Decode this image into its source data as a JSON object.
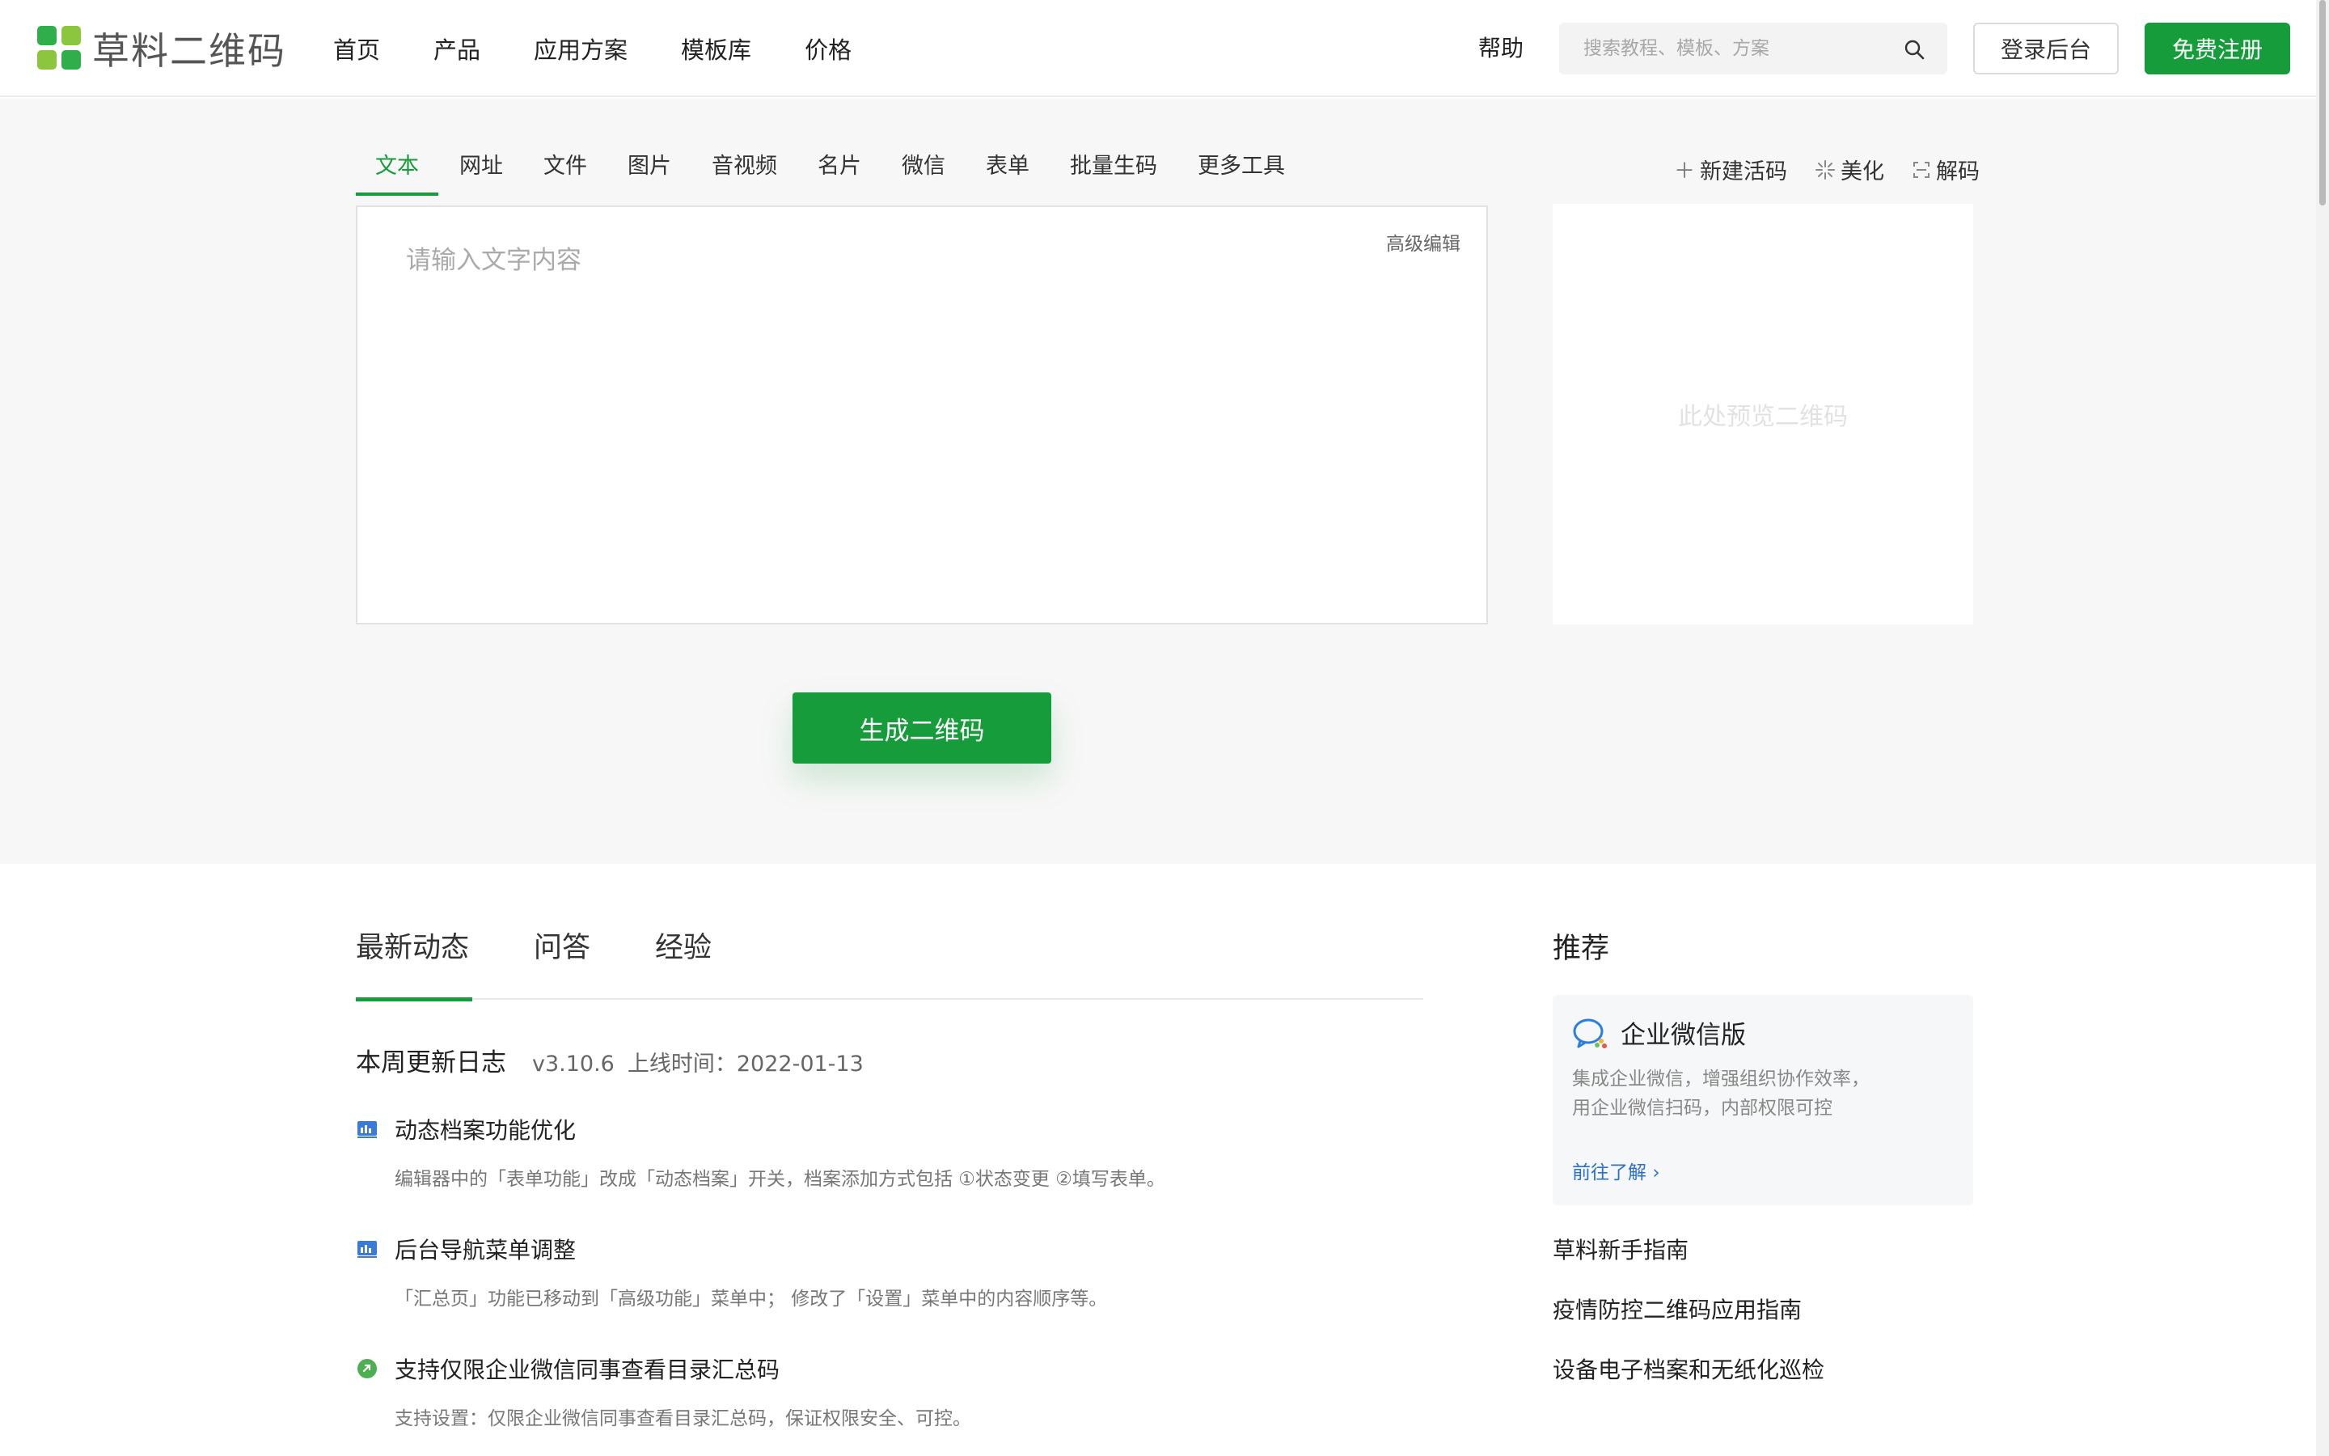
{
  "header": {
    "logo_text": "草料二维码",
    "nav": [
      "首页",
      "产品",
      "应用方案",
      "模板库",
      "价格"
    ],
    "help": "帮助",
    "search_placeholder": "搜索教程、模板、方案",
    "login": "登录后台",
    "register": "免费注册"
  },
  "generator": {
    "tabs": [
      "文本",
      "网址",
      "文件",
      "图片",
      "音视频",
      "名片",
      "微信",
      "表单",
      "批量生码",
      "更多工具"
    ],
    "active_tab": "文本",
    "tools": [
      {
        "icon": "plus-icon",
        "label": "新建活码"
      },
      {
        "icon": "sparkle-icon",
        "label": "美化"
      },
      {
        "icon": "scan-icon",
        "label": "解码"
      }
    ],
    "placeholder": "请输入文字内容",
    "advanced_edit": "高级编辑",
    "preview_text": "此处预览二维码",
    "generate_button": "生成二维码"
  },
  "news": {
    "tabs": [
      "最新动态",
      "问答",
      "经验"
    ],
    "week_title": "本周更新日志",
    "version": "v3.10.6",
    "release": "上线时间：2022-01-13",
    "items": [
      {
        "icon": "chart-icon",
        "title": "动态档案功能优化",
        "desc": "编辑器中的「表单功能」改成「动态档案」开关，档案添加方式包括 ①状态变更 ②填写表单。"
      },
      {
        "icon": "chart-icon",
        "title": "后台导航菜单调整",
        "desc": "「汇总页」功能已移动到「高级功能」菜单中； 修改了「设置」菜单中的内容顺序等。"
      },
      {
        "icon": "wecom-link-icon",
        "title": "支持仅限企业微信同事查看目录汇总码",
        "desc": "支持设置：仅限企业微信同事查看目录汇总码，保证权限安全、可控。"
      }
    ]
  },
  "recommend": {
    "title": "推荐",
    "card": {
      "title": "企业微信版",
      "desc_line1": "集成企业微信，增强组织协作效率，",
      "desc_line2": "用企业微信扫码，内部权限可控",
      "link": "前往了解"
    },
    "links": [
      "草料新手指南",
      "疫情防控二维码应用指南",
      "设备电子档案和无纸化巡检"
    ]
  },
  "colors": {
    "brand": "#169c3a",
    "link": "#2a6fd6"
  }
}
